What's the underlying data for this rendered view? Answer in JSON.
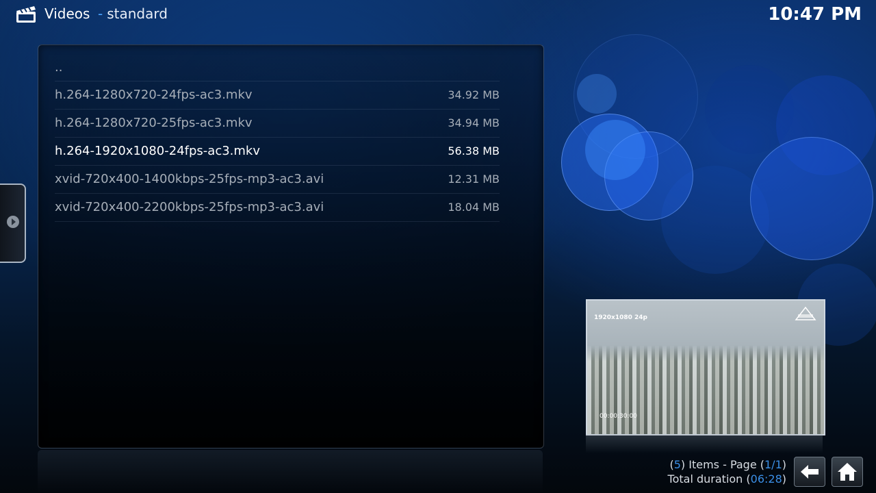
{
  "header": {
    "title": "Videos",
    "subtitle": "standard",
    "clock": "10:47 PM"
  },
  "list": {
    "items": [
      {
        "name": "..",
        "size": ""
      },
      {
        "name": "h.264-1280x720-24fps-ac3.mkv",
        "size": "34.92 MB"
      },
      {
        "name": "h.264-1280x720-25fps-ac3.mkv",
        "size": "34.94 MB"
      },
      {
        "name": "h.264-1920x1080-24fps-ac3.mkv",
        "size": "56.38 MB"
      },
      {
        "name": "xvid-720x400-1400kbps-25fps-mp3-ac3.avi",
        "size": "12.31 MB"
      },
      {
        "name": "xvid-720x400-2200kbps-25fps-mp3-ac3.avi",
        "size": "18.04 MB"
      }
    ],
    "selected_index": 3
  },
  "thumbnail": {
    "resolution_label": "1920x1080 24p",
    "timecode": "00:00:30:00"
  },
  "footer": {
    "items_count": "5",
    "items_label": "Items - Page",
    "page": "1/1",
    "duration_label": "Total duration",
    "duration": "06:28"
  },
  "icons": {
    "app": "clapperboard-icon",
    "side": "arrow-right-icon",
    "back": "back-arrow-icon",
    "home": "home-icon"
  },
  "colors": {
    "accent": "#3b8fe6",
    "background": "#0b2f63"
  }
}
